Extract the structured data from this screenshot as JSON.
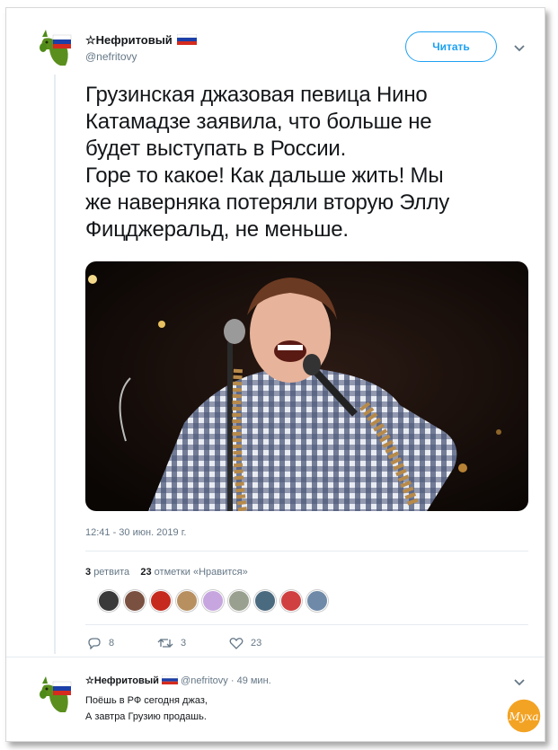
{
  "tweet": {
    "author_name": "☆Нефритовый",
    "author_handle": "@nefritovy",
    "follow_label": "Читать",
    "text": "Грузинская джазовая певица Нино\nКатамадзе заявила, что больше не\nбудет выступать в России.\nГоре то какое! Как дальше жить! Мы\nже наверняка потеряли вторую Эллу\nФицджеральд, не меньше.",
    "timestamp": "12:41 - 30 июн. 2019 г.",
    "retweets_count": "3",
    "retweets_label": "ретвита",
    "likes_count": "23",
    "likes_label": "отметки «Нравится»",
    "actions": {
      "replies": "8",
      "retweets": "3",
      "likes": "23"
    }
  },
  "reply": {
    "author_name": "☆Нефритовый",
    "author_handle": "@nefritovy",
    "time_ago": "· 49 мин.",
    "text": "Поёшь в РФ сегодня джаз,\nА завтра Грузию продашь."
  },
  "icons": {
    "avatar": "green-goat-with-russian-flag",
    "flag": "russian-flag-icon",
    "reply": "reply-bubble-icon",
    "retweet": "retweet-arrows-icon",
    "like": "heart-outline-icon",
    "more": "chevron-down-icon",
    "watermark": "logo-badge"
  },
  "watermark_text": "Муха",
  "colors": {
    "accent": "#1da1f2",
    "avatar_green": "#5a8f1e",
    "muted": "#657786",
    "logo_orange": "#f3a324"
  }
}
